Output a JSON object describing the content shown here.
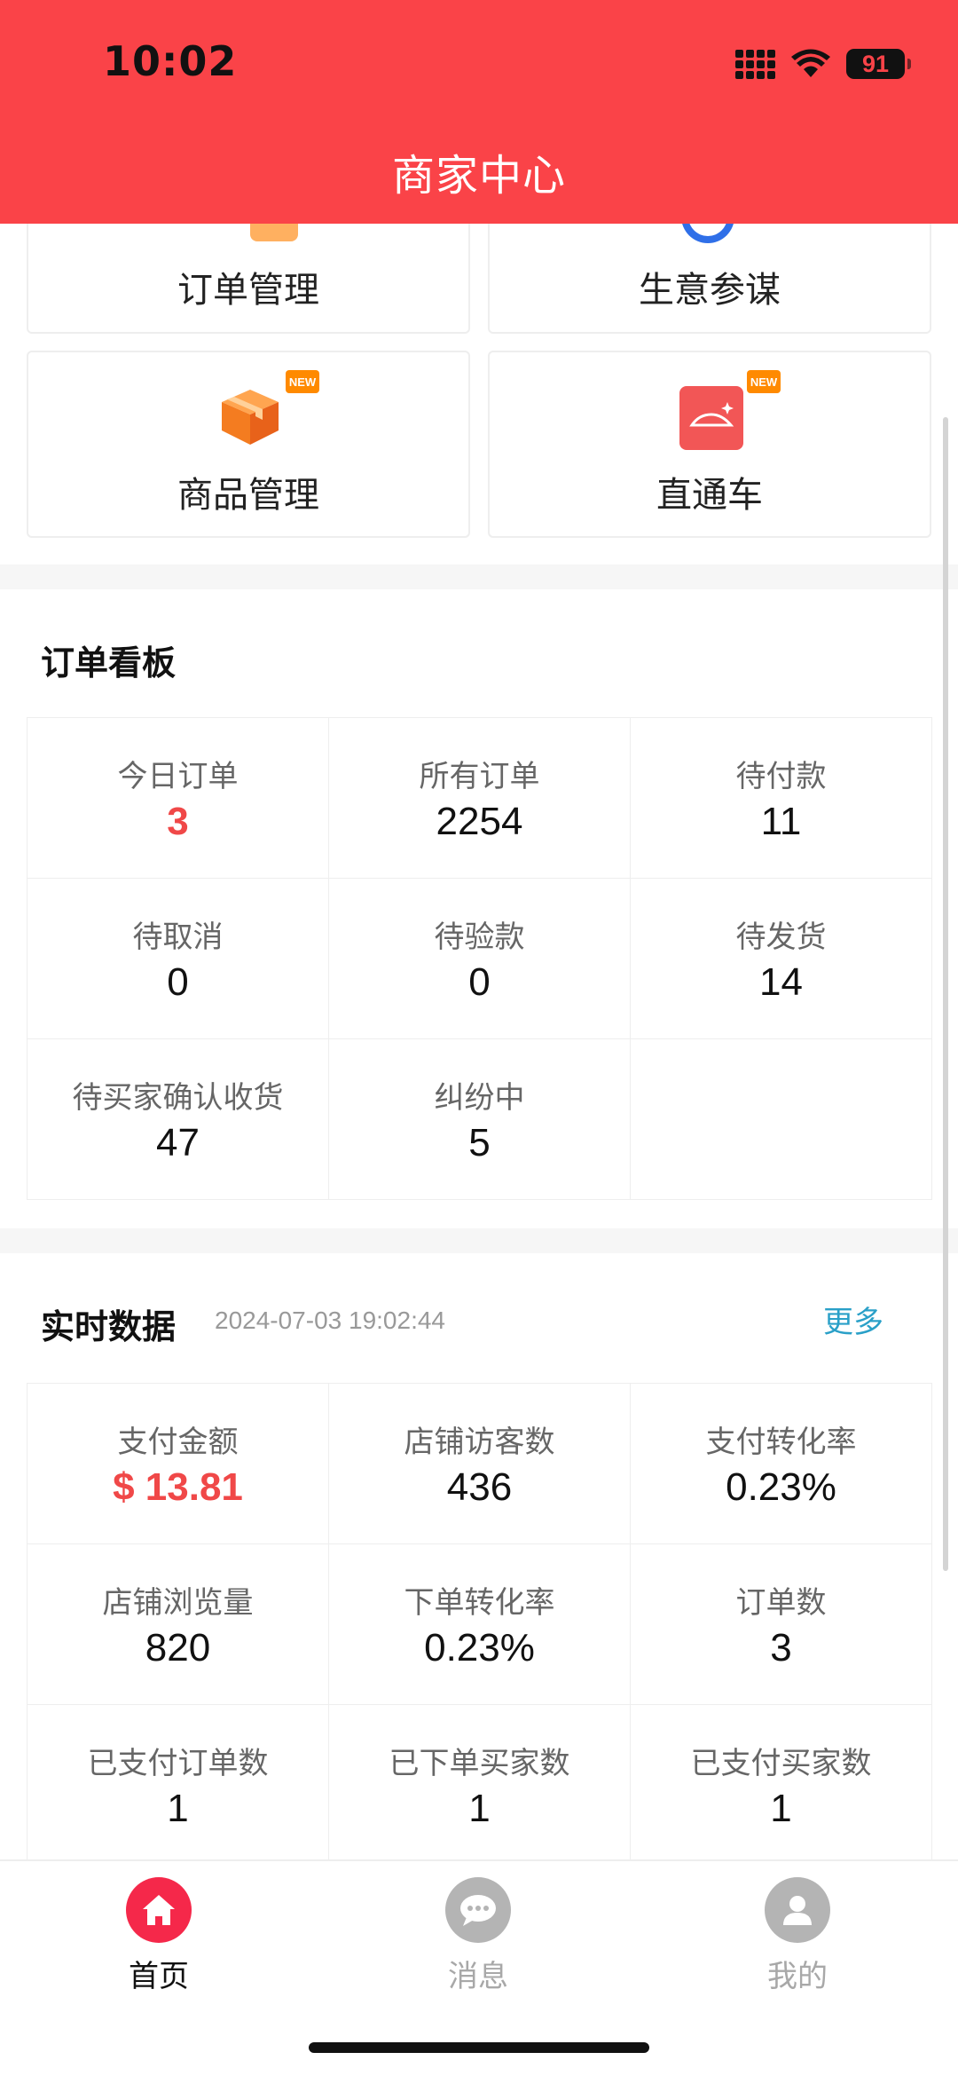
{
  "status_bar": {
    "time": "10:02",
    "battery": "91"
  },
  "header": {
    "title": "商家中心"
  },
  "features": [
    {
      "label": "订单管理",
      "icon": "order-icon"
    },
    {
      "label": "生意参谋",
      "icon": "analytics-icon"
    },
    {
      "label": "商品管理",
      "icon": "package-box-icon",
      "badge": "NEW"
    },
    {
      "label": "直通车",
      "icon": "car-icon",
      "badge": "NEW"
    }
  ],
  "order_board": {
    "title": "订单看板",
    "cells": [
      {
        "label": "今日订单",
        "value": "3"
      },
      {
        "label": "所有订单",
        "value": "2254"
      },
      {
        "label": "待付款",
        "value": "11"
      },
      {
        "label": "待取消",
        "value": "0"
      },
      {
        "label": "待验款",
        "value": "0"
      },
      {
        "label": "待发货",
        "value": "14"
      },
      {
        "label": "待买家确认收货",
        "value": "47"
      },
      {
        "label": "纠纷中",
        "value": "5"
      }
    ]
  },
  "realtime": {
    "title": "实时数据",
    "timestamp": "2024-07-03 19:02:44",
    "more": "更多",
    "cells": [
      {
        "label": "支付金额",
        "value": "$ 13.81"
      },
      {
        "label": "店铺访客数",
        "value": "436"
      },
      {
        "label": "支付转化率",
        "value": "0.23%"
      },
      {
        "label": "店铺浏览量",
        "value": "820"
      },
      {
        "label": "下单转化率",
        "value": "0.23%"
      },
      {
        "label": "订单数",
        "value": "3"
      },
      {
        "label": "已支付订单数",
        "value": "1"
      },
      {
        "label": "已下单买家数",
        "value": "1"
      },
      {
        "label": "已支付买家数",
        "value": "1"
      }
    ]
  },
  "tabbar": [
    {
      "label": "首页",
      "icon": "home-icon",
      "active": true
    },
    {
      "label": "消息",
      "icon": "message-icon",
      "active": false
    },
    {
      "label": "我的",
      "icon": "user-icon",
      "active": false
    }
  ],
  "colors": {
    "brand": "#fa4348",
    "value_red": "#f04848",
    "link": "#2aa0c8",
    "inactive": "#b0b0b0"
  }
}
